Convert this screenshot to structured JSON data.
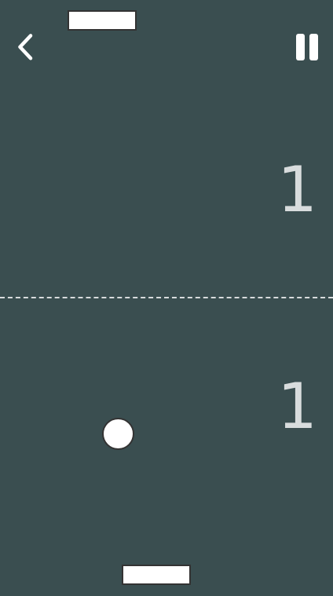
{
  "colors": {
    "background": "#3a4e50",
    "foreground": "#ffffff",
    "score": "#d8dcdd"
  },
  "controls": {
    "back_icon": "chevron-left-icon",
    "pause_icon": "pause-icon"
  },
  "scores": {
    "opponent": "1",
    "player": "1"
  }
}
